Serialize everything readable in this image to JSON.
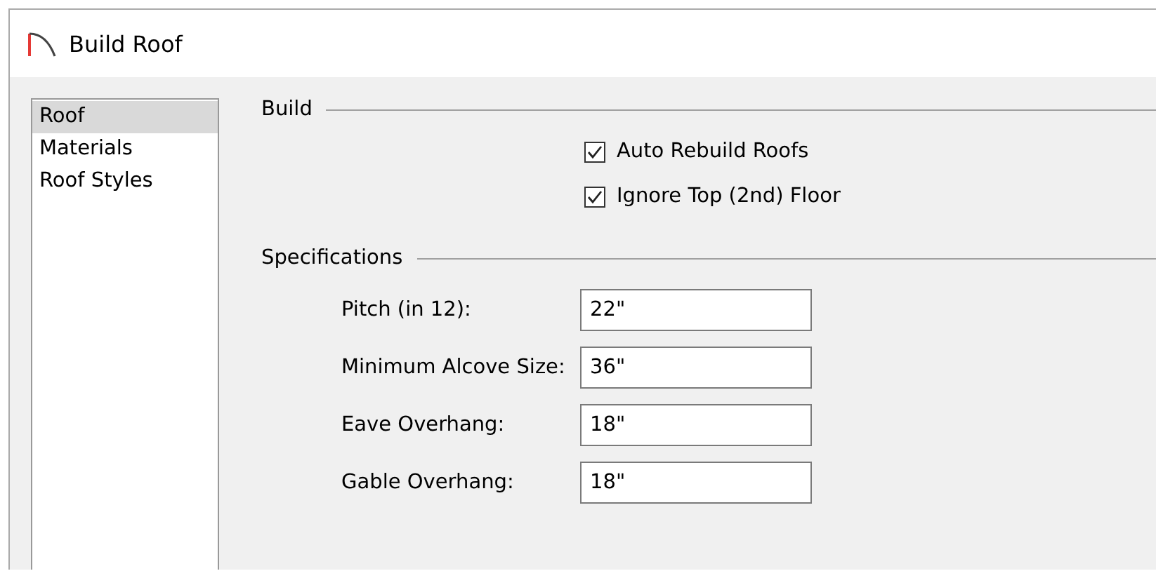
{
  "window": {
    "title": "Build Roof"
  },
  "sidebar": {
    "items": [
      {
        "label": "Roof",
        "selected": true
      },
      {
        "label": "Materials",
        "selected": false
      },
      {
        "label": "Roof Styles",
        "selected": false
      }
    ]
  },
  "build": {
    "title": "Build",
    "options": [
      {
        "label": "Auto Rebuild Roofs",
        "checked": true
      },
      {
        "label": "Ignore Top (2nd) Floor",
        "checked": true
      }
    ]
  },
  "specifications": {
    "title": "Specifications",
    "fields": [
      {
        "label": "Pitch (in 12):",
        "value": "22\""
      },
      {
        "label": "Minimum Alcove Size:",
        "value": "36\""
      },
      {
        "label": "Eave Overhang:",
        "value": "18\""
      },
      {
        "label": "Gable Overhang:",
        "value": "18\""
      }
    ]
  }
}
